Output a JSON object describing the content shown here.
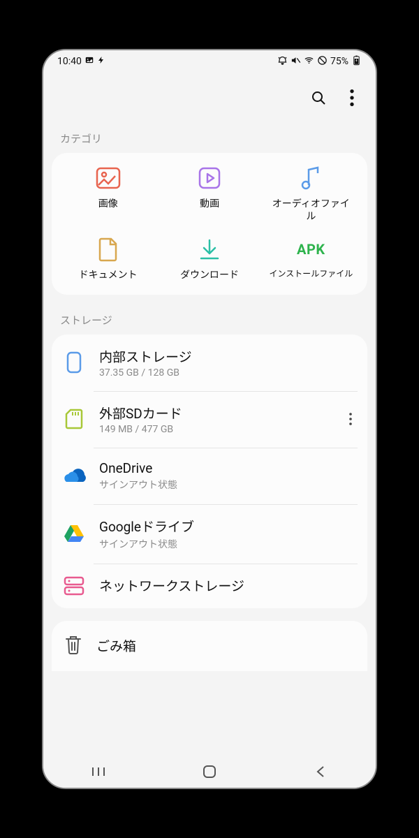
{
  "statusbar": {
    "time": "10:40",
    "battery": "75%"
  },
  "sections": {
    "category_label": "カテゴリ",
    "storage_label": "ストレージ"
  },
  "categories": [
    {
      "label": "画像"
    },
    {
      "label": "動画"
    },
    {
      "label": "オーディオファイル"
    },
    {
      "label": "ドキュメント"
    },
    {
      "label": "ダウンロード"
    },
    {
      "label": "インストールファイル"
    }
  ],
  "storage": [
    {
      "title": "内部ストレージ",
      "sub": "37.35 GB / 128 GB"
    },
    {
      "title": "外部SDカード",
      "sub": "149 MB / 477 GB"
    },
    {
      "title": "OneDrive",
      "sub": "サインアウト状態"
    },
    {
      "title": "Googleドライブ",
      "sub": "サインアウト状態"
    },
    {
      "title": "ネットワークストレージ",
      "sub": ""
    }
  ],
  "trash": {
    "label": "ごみ箱"
  },
  "apk_label": "APK"
}
